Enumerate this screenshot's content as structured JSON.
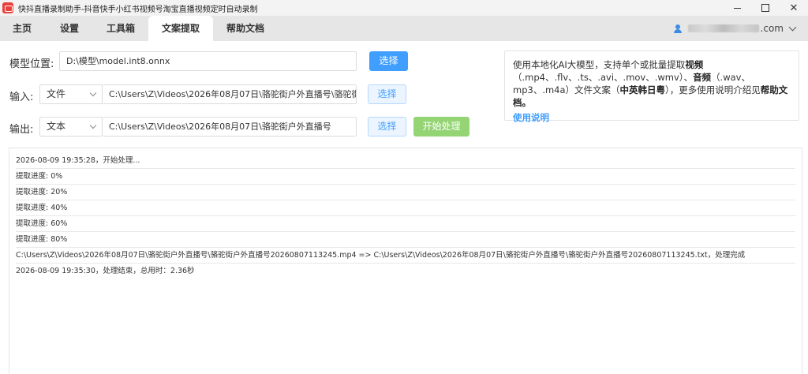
{
  "window": {
    "title": "快抖直播录制助手-抖音快手小红书视频号淘宝直播视频定时自动录制",
    "controls": {
      "minimize": "",
      "maximize": "",
      "close": "✕"
    }
  },
  "tabs": [
    {
      "label": "主页"
    },
    {
      "label": "设置"
    },
    {
      "label": "工具箱"
    },
    {
      "label": "文案提取"
    },
    {
      "label": "帮助文档"
    }
  ],
  "user": {
    "domain": ".com"
  },
  "form": {
    "model_label": "模型位置:",
    "model_path": "D:\\模型\\model.int8.onnx",
    "model_button": "选择",
    "input_label": "输入:",
    "input_type": "文件",
    "input_path": "C:\\Users\\Z\\Videos\\2026年08月07日\\骆驼街户外直播号\\骆驼街",
    "input_button": "选择",
    "output_label": "输出:",
    "output_type": "文本",
    "output_path": "C:\\Users\\Z\\Videos\\2026年08月07日\\骆驼街户外直播号",
    "output_button": "选择",
    "start_button": "开始处理"
  },
  "info": {
    "t1": "使用本地化AI大模型，支持单个或批量提取",
    "b1": "视频",
    "t2": "（.mp4、.flv、.ts、.avi、.mov、.wmv）、",
    "b2": "音频",
    "t3": "（.wav、mp3、.m4a）文件文案（",
    "b3": "中英韩日粤",
    "t4": "），更多使用说明介绍见",
    "b4": "帮助文档。",
    "link": "使用说明"
  },
  "log": [
    "2026-08-09 19:35:28，开始处理...",
    "提取进度: 0%",
    "提取进度: 20%",
    "提取进度: 40%",
    "提取进度: 60%",
    "提取进度: 80%",
    "C:\\Users\\Z\\Videos\\2026年08月07日\\骆驼街户外直播号\\骆驼街户外直播号20260807113245.mp4 => C:\\Users\\Z\\Videos\\2026年08月07日\\骆驼街户外直播号\\骆驼街户外直播号20260807113245.txt，处理完成",
    "2026-08-09 19:35:30，处理结束，总用时：2.36秒"
  ]
}
